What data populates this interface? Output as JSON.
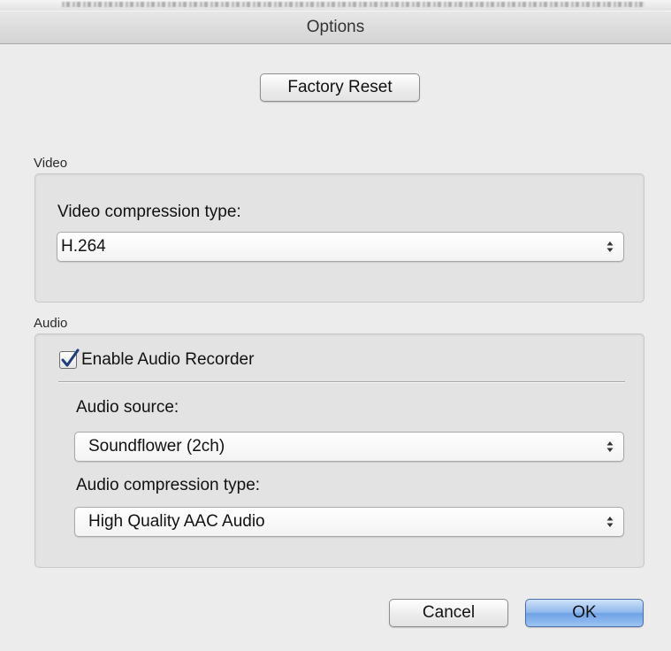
{
  "window": {
    "title": "Options"
  },
  "buttons": {
    "factory_reset": "Factory Reset",
    "cancel": "Cancel",
    "ok": "OK"
  },
  "video_group": {
    "title": "Video",
    "compression_label": "Video compression type:",
    "compression_value": "H.264"
  },
  "audio_group": {
    "title": "Audio",
    "enable_label": "Enable Audio Recorder",
    "enable_checked": true,
    "source_label": "Audio source:",
    "source_value": "Soundflower (2ch)",
    "compression_label": "Audio compression type:",
    "compression_value": "High Quality AAC Audio"
  },
  "icons": {
    "checkbox": "checkmark-icon",
    "select": "updown-arrows-icon"
  },
  "colors": {
    "window_bg": "#ececec",
    "ok_button": "#8fb8ec",
    "checkmark": "#1f3f7a"
  }
}
